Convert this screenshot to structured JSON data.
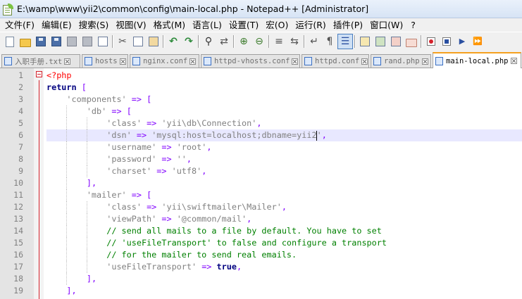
{
  "window": {
    "title": "E:\\wamp\\www\\yii2\\common\\config\\main-local.php - Notepad++ [Administrator]"
  },
  "menu": [
    "文件(F)",
    "编辑(E)",
    "搜索(S)",
    "视图(V)",
    "格式(M)",
    "语言(L)",
    "设置(T)",
    "宏(O)",
    "运行(R)",
    "插件(P)",
    "窗口(W)",
    "?"
  ],
  "toolbar": {
    "icons": [
      "new-file-icon",
      "open-file-icon",
      "save-icon",
      "save-all-icon",
      "close-icon",
      "close-all-icon",
      "print-icon",
      "cut-icon",
      "copy-icon",
      "paste-icon",
      "undo-icon",
      "redo-icon",
      "find-icon",
      "replace-icon",
      "zoom-in-icon",
      "zoom-out-icon",
      "sync-scroll-v-icon",
      "sync-scroll-h-icon",
      "word-wrap-icon",
      "show-all-chars-icon",
      "indent-guide-icon",
      "user-language-icon",
      "doc-map-icon",
      "function-list-icon",
      "folder-as-workspace-icon",
      "macro-record-icon",
      "macro-stop-icon",
      "macro-play-icon",
      "macro-run-multiple-icon"
    ],
    "active_icon": "indent-guide-icon"
  },
  "tabs": [
    {
      "label": "入职手册.txt",
      "active": false
    },
    {
      "label": "hosts",
      "active": false
    },
    {
      "label": "nginx.conf",
      "active": false
    },
    {
      "label": "httpd-vhosts.conf",
      "active": false
    },
    {
      "label": "httpd.conf",
      "active": false
    },
    {
      "label": "rand.php",
      "active": false
    },
    {
      "label": "main-local.php",
      "active": true
    }
  ],
  "editor": {
    "language": "php",
    "current_line": 6,
    "lines": [
      {
        "n": "1",
        "text": "<?php"
      },
      {
        "n": "2",
        "text": "return ["
      },
      {
        "n": "3",
        "text": "    'components' => ["
      },
      {
        "n": "4",
        "text": "        'db' => ["
      },
      {
        "n": "5",
        "text": "            'class' => 'yii\\db\\Connection',"
      },
      {
        "n": "6",
        "text": "            'dsn' => 'mysql:host=localhost;dbname=yii2',"
      },
      {
        "n": "7",
        "text": "            'username' => 'root',"
      },
      {
        "n": "8",
        "text": "            'password' => '',"
      },
      {
        "n": "9",
        "text": "            'charset' => 'utf8',"
      },
      {
        "n": "10",
        "text": "        ],"
      },
      {
        "n": "11",
        "text": "        'mailer' => ["
      },
      {
        "n": "12",
        "text": "            'class' => 'yii\\swiftmailer\\Mailer',"
      },
      {
        "n": "13",
        "text": "            'viewPath' => '@common/mail',"
      },
      {
        "n": "14",
        "text": "            // send all mails to a file by default. You have to set"
      },
      {
        "n": "15",
        "text": "            // 'useFileTransport' to false and configure a transport"
      },
      {
        "n": "16",
        "text": "            // for the mailer to send real emails."
      },
      {
        "n": "17",
        "text": "            'useFileTransport' => true,"
      },
      {
        "n": "18",
        "text": "        ],"
      },
      {
        "n": "19",
        "text": "    ],"
      }
    ]
  },
  "colors": {
    "keyword": "#000080",
    "string": "#808080",
    "operator": "#8000ff",
    "comment": "#008000",
    "php_tag": "#ff0000",
    "current_line_bg": "#e8e8ff",
    "active_tab_accent": "#f5a020"
  }
}
